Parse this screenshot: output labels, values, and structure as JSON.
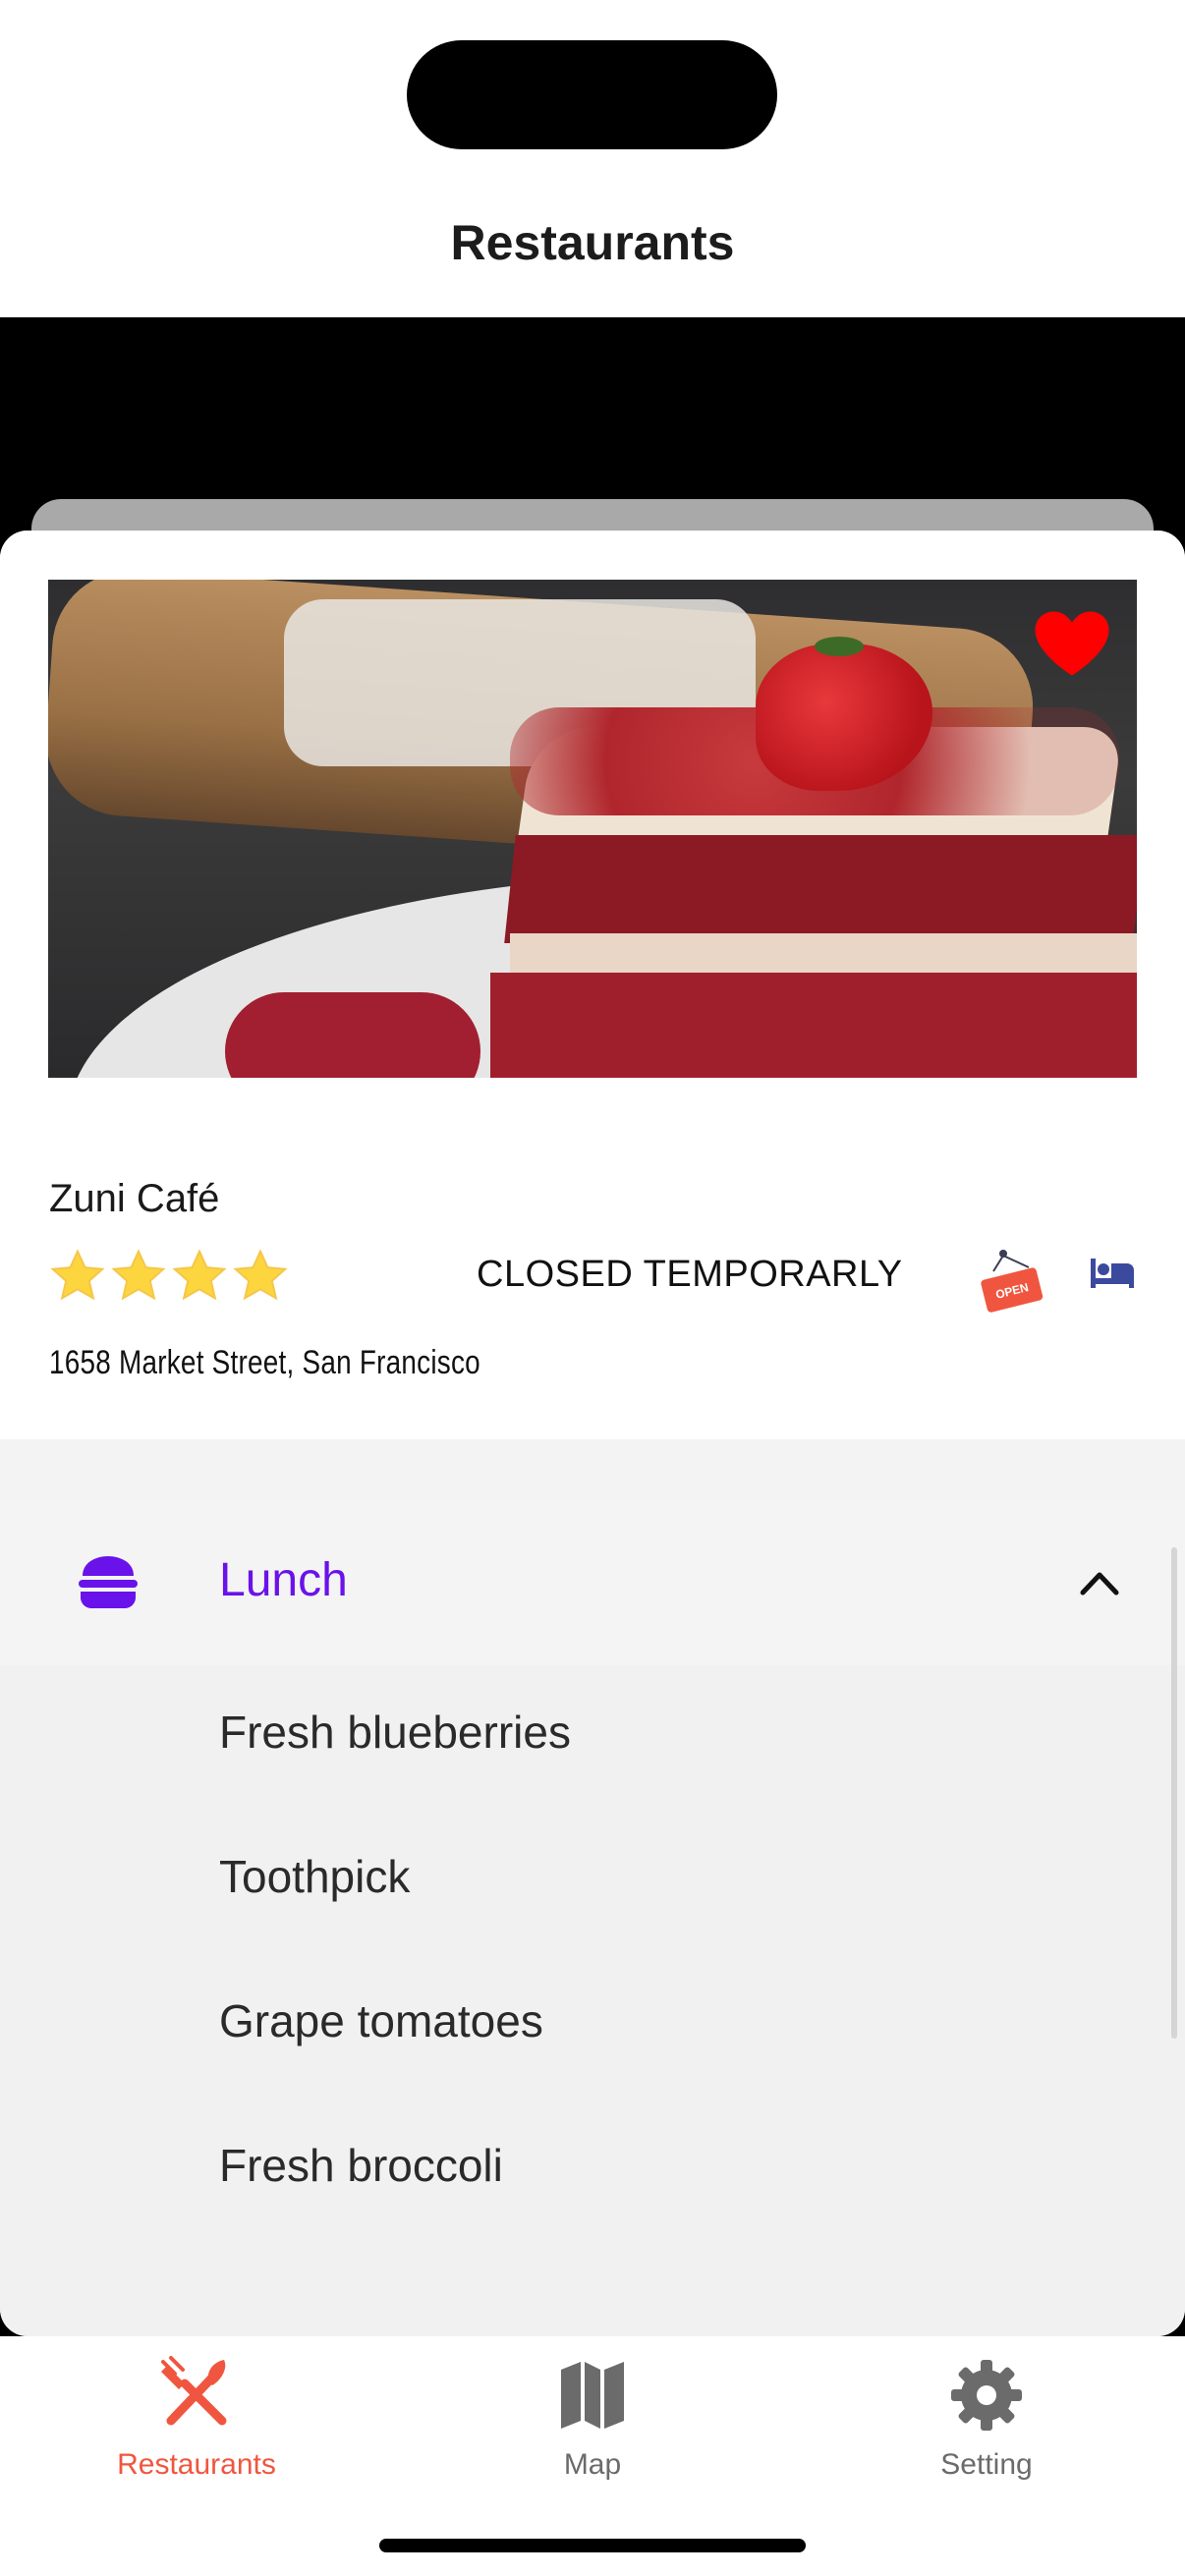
{
  "header": {
    "title": "Restaurants"
  },
  "restaurant": {
    "name": "Zuni Café",
    "rating": 4,
    "rating_max": 4,
    "status": "CLOSED TEMPORARLY",
    "open_sign_text": "OPEN",
    "address": "1658 Market Street, San Francisco",
    "favorited": true,
    "favorite_color": "#ff0000"
  },
  "menu_section": {
    "title": "Lunch",
    "icon": "burger-icon",
    "expanded": true,
    "accent": "#6a12ea",
    "items": [
      {
        "label": "Fresh blueberries"
      },
      {
        "label": "Toothpick"
      },
      {
        "label": "Grape tomatoes"
      },
      {
        "label": "Fresh broccoli"
      }
    ]
  },
  "tabbar": {
    "active_color": "#f0563f",
    "inactive_color": "#6b6b6b",
    "tabs": [
      {
        "label": "Restaurants",
        "icon": "utensils-icon",
        "active": true
      },
      {
        "label": "Map",
        "icon": "map-icon",
        "active": false
      },
      {
        "label": "Setting",
        "icon": "gear-icon",
        "active": false
      }
    ]
  }
}
